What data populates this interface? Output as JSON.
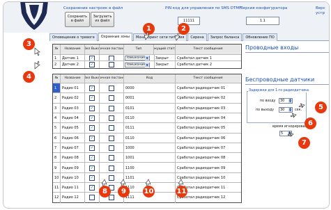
{
  "topbar": {
    "save_settings_label": "Сохранение настроек в файл",
    "save_btn_l1": "Сохранить",
    "save_btn_l2": "в файл",
    "load_btn_l1": "Загрузить",
    "load_btn_l2": "из файл",
    "pin_label": "PIN код для управления по SMS DTMF",
    "pin_value": "11111",
    "fw_label": "Версия конфигуратора",
    "fw_value": "1.1",
    "extra_label_1": "Верс",
    "extra_label_2": "устр"
  },
  "tabs": [
    {
      "label": "Оповещение о тревоге"
    },
    {
      "label": "Охранные зоны"
    },
    {
      "label": "Мониторинг сети питания"
    },
    {
      "label": "Сирена"
    },
    {
      "label": "Запрос баланса"
    },
    {
      "label": "Обновление ПО"
    }
  ],
  "wired_table": {
    "headers": [
      "№",
      "Название",
      "Вкл Выкл",
      "Частичная постановка",
      "Тип",
      "Текущий статус",
      "Текст сообщения"
    ],
    "rows": [
      {
        "num": "1",
        "name": "Датчик 1",
        "on": true,
        "partial": false,
        "type": "Замыкание",
        "status": "Закрыт",
        "text": "Сработал датчик 1"
      },
      {
        "num": "2",
        "name": "Датчик 2",
        "on": true,
        "partial": false,
        "type": "Замыкание",
        "status": "Закрыт",
        "text": "Сработал датчик 2"
      }
    ]
  },
  "wireless_table": {
    "headers": [
      "№",
      "Название",
      "Вкл Выкл",
      "Частичная постановка",
      "Код",
      "Текст сообщения"
    ],
    "rows": [
      {
        "num": "1",
        "name": "Радио 01",
        "on": true,
        "partial": false,
        "code": "0000",
        "text": "Сработал радиодатчик 01"
      },
      {
        "num": "2",
        "name": "Радио 02",
        "on": true,
        "partial": false,
        "code": "0001",
        "text": "Сработал радиодатчик 02"
      },
      {
        "num": "3",
        "name": "Радио 03",
        "on": true,
        "partial": false,
        "code": "0101",
        "text": "Сработал радиодатчик 03"
      },
      {
        "num": "4",
        "name": "Радио 04",
        "on": true,
        "partial": false,
        "code": "0110",
        "text": "Сработал радиодатчик 04"
      },
      {
        "num": "5",
        "name": "Радио 05",
        "on": true,
        "partial": false,
        "code": "0111",
        "text": "Сработал радиодатчик 05"
      },
      {
        "num": "6",
        "name": "Радио 06",
        "on": true,
        "partial": false,
        "code": "0110",
        "text": "Сработал радиодатчик 06"
      },
      {
        "num": "7",
        "name": "Радио 07",
        "on": true,
        "partial": false,
        "code": "1000",
        "text": "Сработал радиодатчик 07"
      },
      {
        "num": "8",
        "name": "Радио 08",
        "on": true,
        "partial": false,
        "code": "1001",
        "text": "Сработал радиодатчик 08"
      },
      {
        "num": "9",
        "name": "Радио 09",
        "on": true,
        "partial": false,
        "code": "1100",
        "text": "Сработал радиодатчик 09"
      },
      {
        "num": "10",
        "name": "Радио 10",
        "on": true,
        "partial": false,
        "code": "1101",
        "text": "Сработал радиодатчик 10"
      },
      {
        "num": "11",
        "name": "Радио 11",
        "on": true,
        "partial": false,
        "code": "1110",
        "text": "Сработал радиодатчик 11"
      },
      {
        "num": "12",
        "name": "Радио 12",
        "on": false,
        "partial": false,
        "code": "1111",
        "text": "Сработал радиодатчик 12"
      }
    ]
  },
  "right_panel": {
    "wired_title": "Проводные входы",
    "wireless_title": "Беспроводные датчики",
    "delay_group_title": "Задержки для 1-го радиодатчика",
    "entry_label": "по входу",
    "entry_value": "30",
    "exit_label": "по выходу",
    "exit_value": "30",
    "sec_label": "сек.",
    "ignore_label": "время игнорирования",
    "ignore_value": "5"
  },
  "callouts": [
    "1",
    "2",
    "3",
    "4",
    "5",
    "6",
    "7",
    "8",
    "9",
    "10",
    "11"
  ],
  "colors": {
    "callout": "#e8380d",
    "accent": "#1a4fb0",
    "check": "#1a8a1a"
  }
}
